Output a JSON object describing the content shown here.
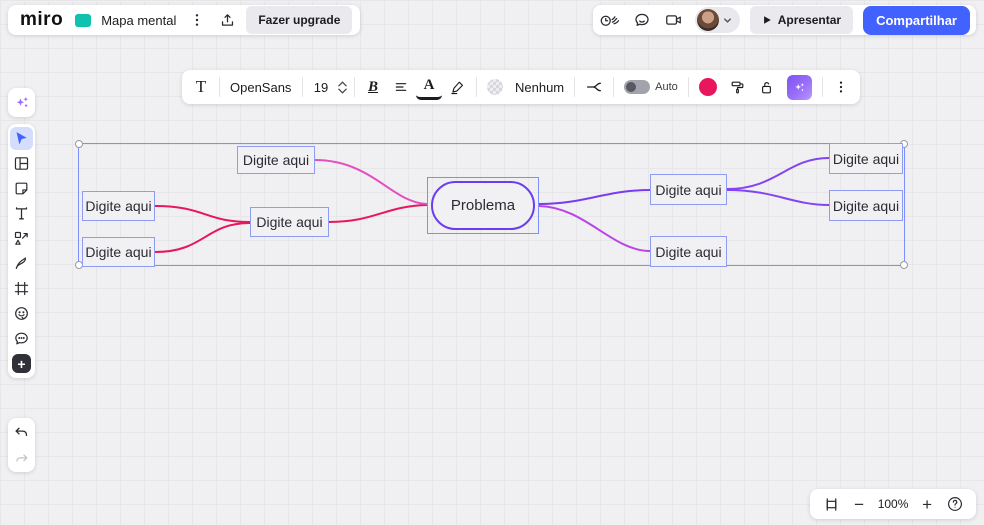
{
  "header": {
    "logo_text": "miro",
    "board_title": "Mapa mental",
    "upgrade_button": "Fazer upgrade",
    "present_button": "Apresentar",
    "share_button": "Compartilhar"
  },
  "format_toolbar": {
    "text_tool": "T",
    "font_name": "OpenSans",
    "font_size": "19",
    "bold_label": "B",
    "text_color_label": "A",
    "border_style_value": "Nenhum",
    "auto_toggle_label": "Auto",
    "selected_color": "#e8175d",
    "accent_blue": "#4262ff"
  },
  "mindmap": {
    "center": {
      "label": "Problema"
    },
    "nodes": [
      {
        "id": "top-left-branch",
        "label": "Digite aqui"
      },
      {
        "id": "left-1",
        "label": "Digite aqui"
      },
      {
        "id": "left-2",
        "label": "Digite aqui"
      },
      {
        "id": "mid-left",
        "label": "Digite aqui"
      },
      {
        "id": "mid-right-upper",
        "label": "Digite aqui"
      },
      {
        "id": "mid-right-lower",
        "label": "Digite aqui"
      },
      {
        "id": "right-1",
        "label": "Digite aqui"
      },
      {
        "id": "right-2",
        "label": "Digite aqui"
      }
    ],
    "edges": [
      {
        "from": "left-1",
        "to": "mid-left",
        "color": "#e8175d"
      },
      {
        "from": "left-2",
        "to": "mid-left",
        "color": "#e8175d"
      },
      {
        "from": "mid-left",
        "to": "center",
        "color": "#e8175d"
      },
      {
        "from": "top-left-branch",
        "to": "center",
        "color": "#e34fc0"
      },
      {
        "from": "center",
        "to": "mid-right-upper",
        "color": "#7a3bf2"
      },
      {
        "from": "center",
        "to": "mid-right-lower",
        "color": "#bb44e6"
      },
      {
        "from": "mid-right-upper",
        "to": "right-1",
        "color": "#8544f2"
      },
      {
        "from": "mid-right-upper",
        "to": "right-2",
        "color": "#8544f2"
      }
    ]
  },
  "zoom_controls": {
    "zoom_level": "100%"
  }
}
